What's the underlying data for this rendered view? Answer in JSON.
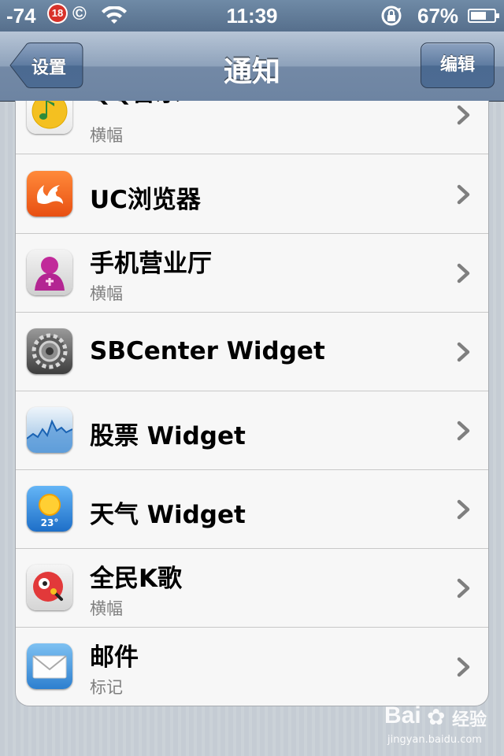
{
  "status_bar": {
    "signal": "-74",
    "age_badge": "18",
    "copyright": "©",
    "time": "11:39",
    "battery_percent_label": "67%",
    "battery_level": 0.67
  },
  "nav": {
    "title": "通知",
    "back_label": "设置",
    "edit_label": "编辑"
  },
  "rows": [
    {
      "title": "QQ音乐",
      "subtitle": "横幅",
      "icon": "qq-music-icon"
    },
    {
      "title": "UC浏览器",
      "subtitle": "",
      "icon": "uc-browser-icon"
    },
    {
      "title": "手机营业厅",
      "subtitle": "横幅",
      "icon": "mobile-hall-icon"
    },
    {
      "title": "SBCenter Widget",
      "subtitle": "",
      "icon": "settings-gear-icon"
    },
    {
      "title": "股票 Widget",
      "subtitle": "",
      "icon": "stocks-icon"
    },
    {
      "title": "天气 Widget",
      "subtitle": "",
      "icon": "weather-icon",
      "icon_text": "23°"
    },
    {
      "title": "全民K歌",
      "subtitle": "横幅",
      "icon": "karaoke-icon"
    },
    {
      "title": "邮件",
      "subtitle": "标记",
      "icon": "mail-icon"
    }
  ],
  "watermark": {
    "brand": "Bai",
    "brand_cn": "经验",
    "url": "jingyan.baidu.com"
  }
}
